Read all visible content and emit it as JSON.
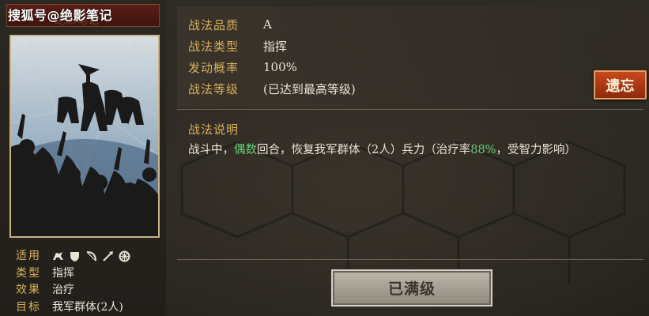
{
  "watermark": "搜狐号@绝影笔记",
  "card": {
    "faded_title": "绝影笔记",
    "attributes": {
      "applicable_label": "适用",
      "applicable_icons": [
        "cavalry-icon",
        "shield-icon",
        "bow-icon",
        "spear-icon",
        "wheel-icon"
      ],
      "type_label": "类型",
      "type_value": "指挥",
      "effect_label": "效果",
      "effect_value": "治疗",
      "target_label": "目标",
      "target_value": "我军群体(2人)"
    }
  },
  "info": {
    "quality_label": "战法品质",
    "quality_value": "A",
    "type_label": "战法类型",
    "type_value": "指挥",
    "chance_label": "发动概率",
    "chance_value": "100%",
    "level_label": "战法等级",
    "level_value": "(已达到最高等级)"
  },
  "description": {
    "title": "战法说明",
    "part1": "战斗中，",
    "highlight1": "偶数",
    "part2": "回合，恢复我军群体（2人）兵力（治疗率",
    "highlight2": "88%",
    "part3": "，受智力影响）"
  },
  "buttons": {
    "forget": "遗忘",
    "maxed": "已满级"
  },
  "colors": {
    "label_gold": "#d8b05a",
    "highlight_green": "#6fcf7a",
    "forget_red": "#b23c14"
  }
}
